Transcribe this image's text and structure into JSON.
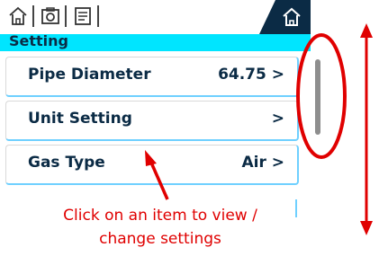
{
  "topbar": {
    "icons": [
      "home-outline-icon",
      "camera-icon",
      "document-icon"
    ],
    "home_icon": "home-icon"
  },
  "section": {
    "title": "Setting"
  },
  "menu": {
    "items": [
      {
        "label": "Pipe Diameter",
        "value": "64.75 >"
      },
      {
        "label": "Unit Setting",
        "value": ">"
      },
      {
        "label": "Gas Type",
        "value": "Air >"
      }
    ]
  },
  "annotation": {
    "line1": "Click on an item to view /",
    "line2": "change settings"
  },
  "colors": {
    "header": "#00e5ff",
    "navy": "#0b2b45",
    "accent_border": "#6fd0ff",
    "annotation_red": "#e00000",
    "scrollbar": "#8e8e8e"
  }
}
